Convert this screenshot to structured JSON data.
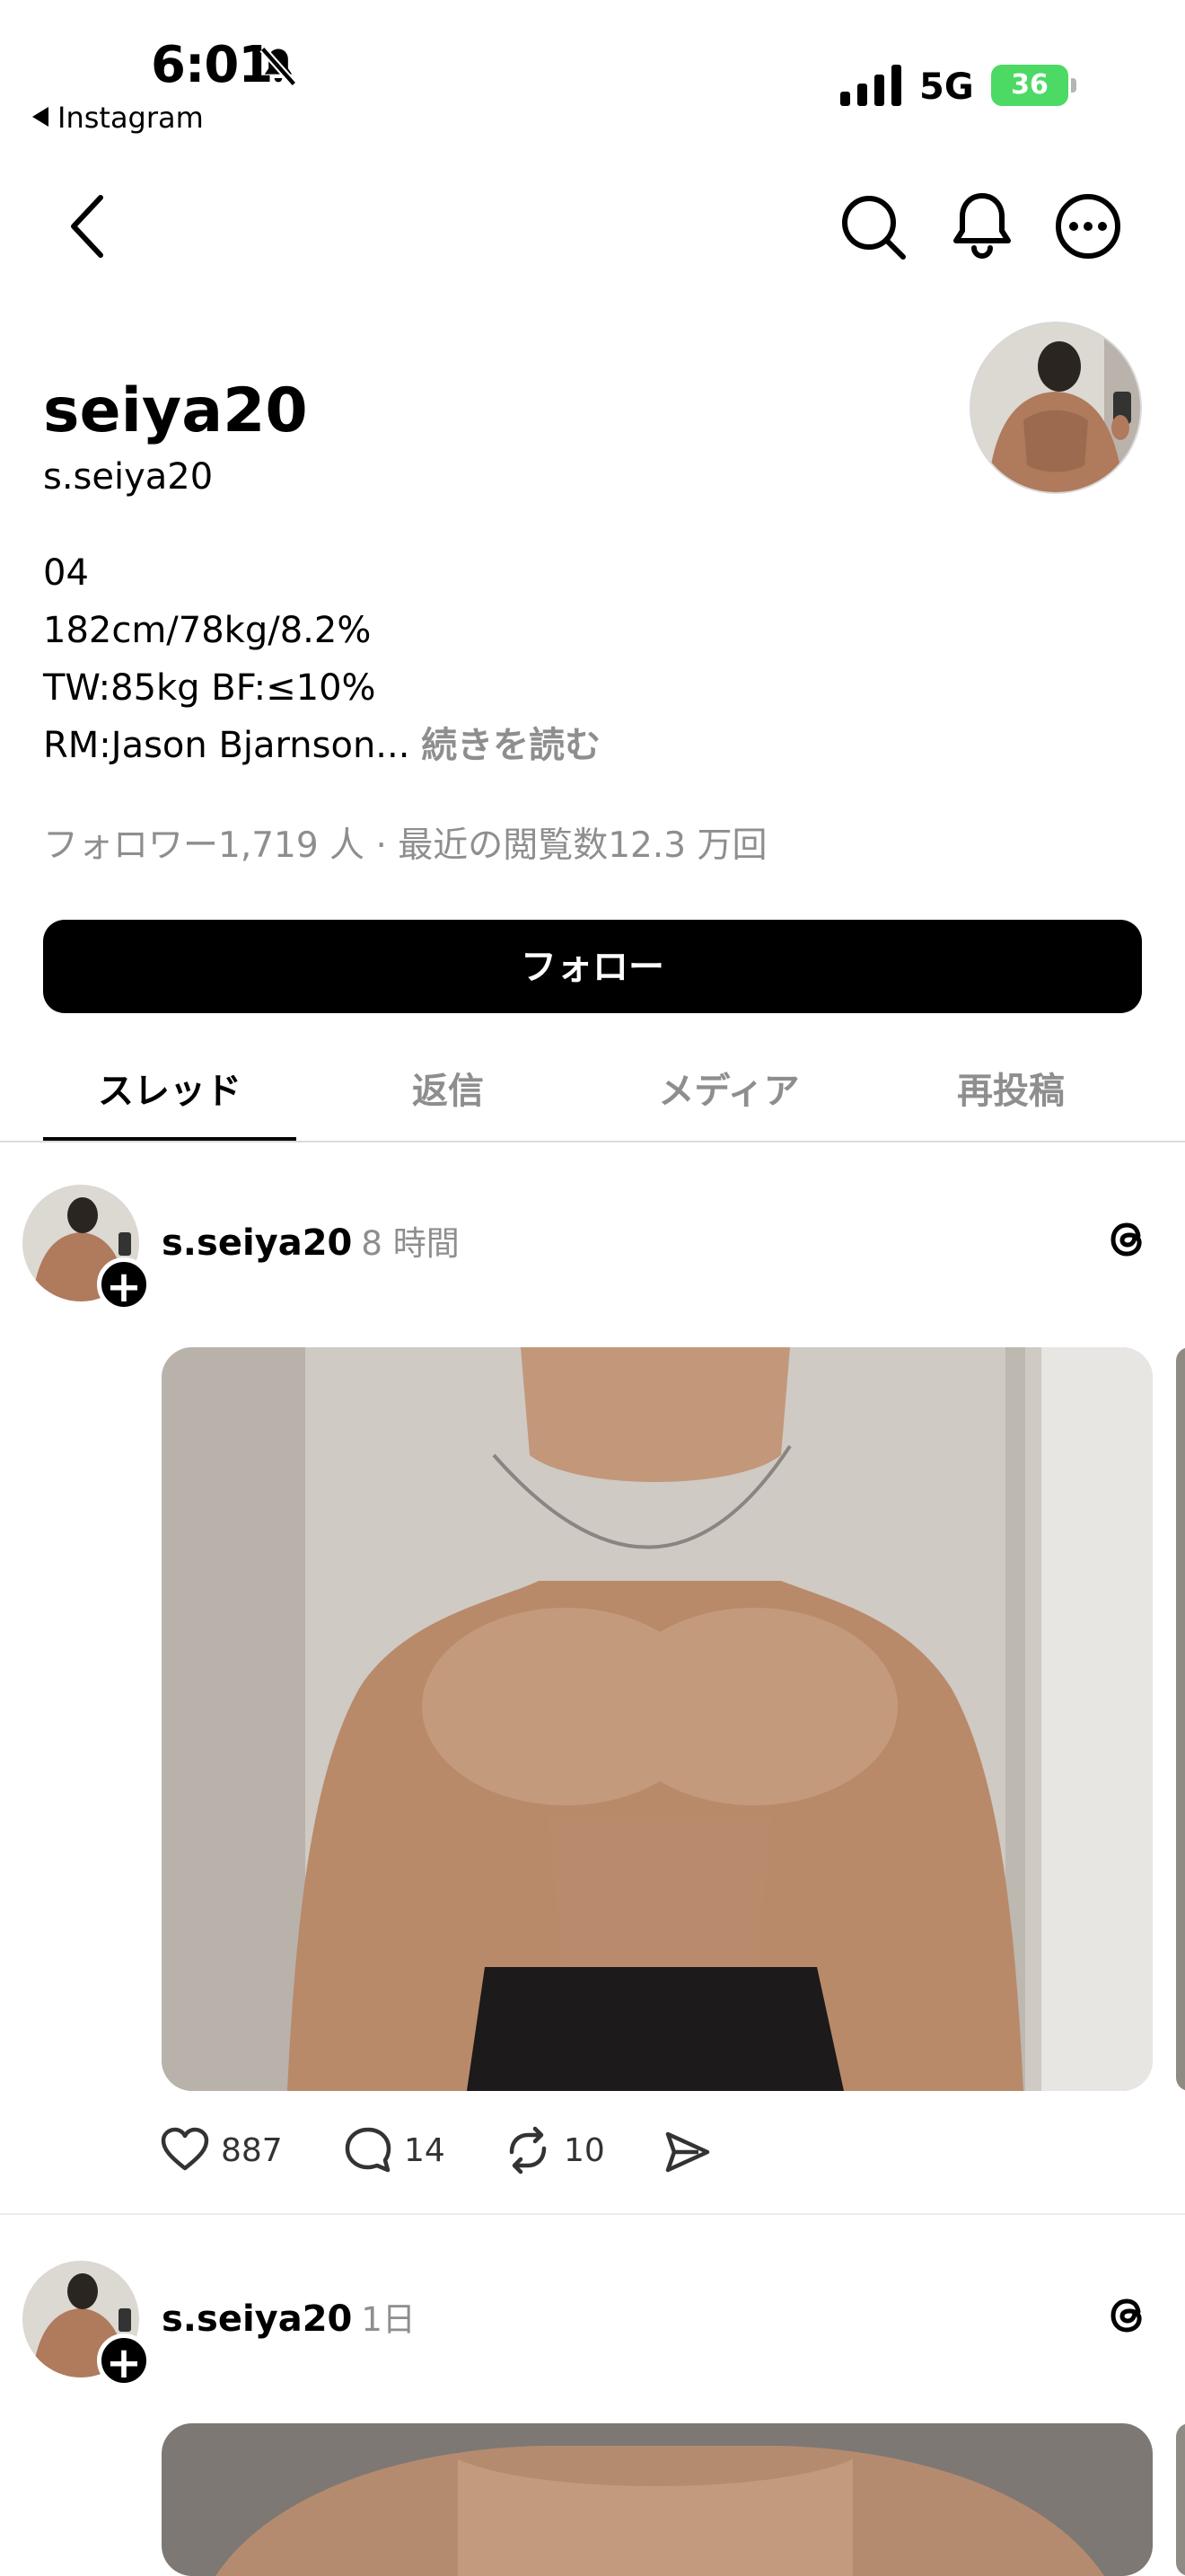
{
  "status_bar": {
    "time": "6:01",
    "back_app": "Instagram",
    "network": "5G",
    "battery": "36"
  },
  "profile": {
    "display_name": "seiya20",
    "username": "s.seiya20",
    "bio_lines": [
      "04",
      "182cm/78kg/8.2%",
      "TW:85kg BF:≤10%",
      "RM:Jason Bjarnson..."
    ],
    "read_more": "続きを読む",
    "stats": "フォロワー1,719 人 · 最近の閲覧数12.3 万回",
    "follow_label": "フォロー"
  },
  "tabs": [
    {
      "label": "スレッド",
      "active": true
    },
    {
      "label": "返信",
      "active": false
    },
    {
      "label": "メディア",
      "active": false
    },
    {
      "label": "再投稿",
      "active": false
    }
  ],
  "posts": [
    {
      "username": "s.seiya20",
      "time": "8 時間",
      "likes": "887",
      "replies": "14",
      "reposts": "10"
    },
    {
      "username": "s.seiya20",
      "time": "1日"
    }
  ],
  "colors": {
    "accent": "#000000",
    "secondary_text": "#8e8e8e",
    "battery": "#4cd964"
  }
}
